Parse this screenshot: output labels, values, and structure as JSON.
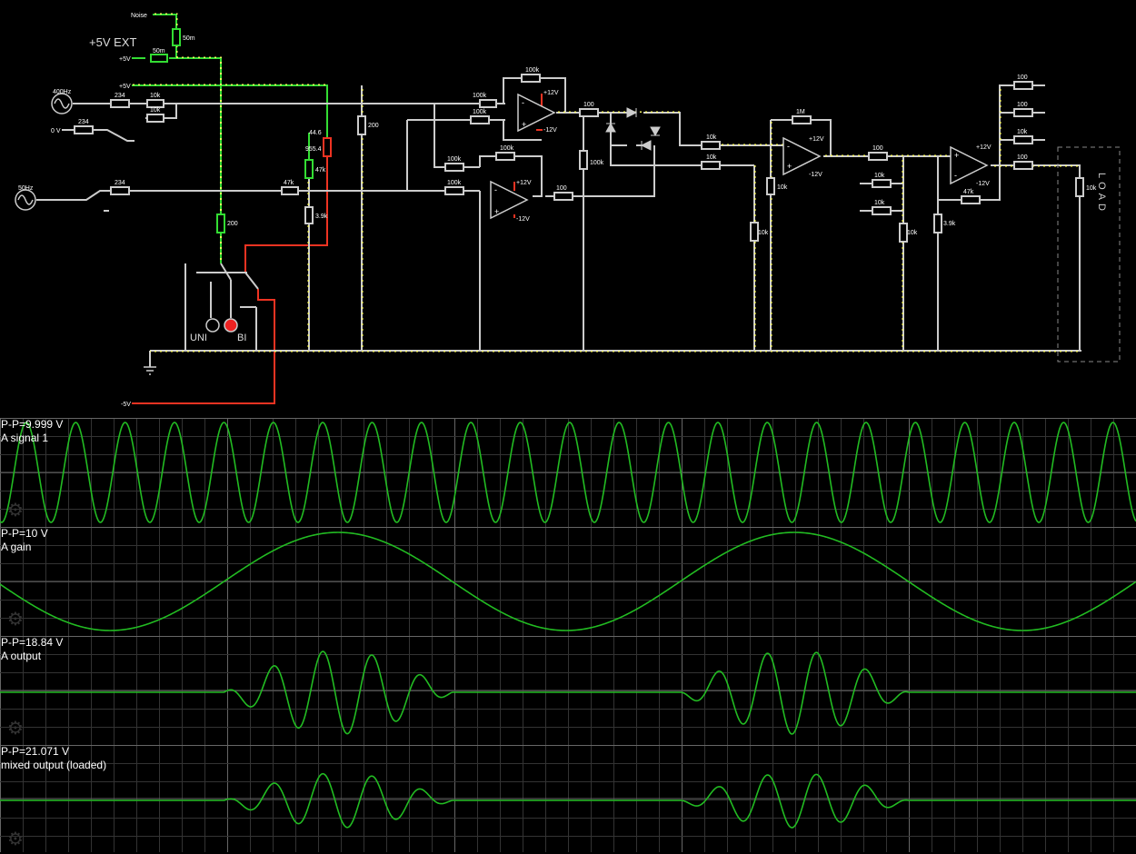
{
  "circuit": {
    "labels": {
      "noise": "Noise",
      "ext": "+5V EXT",
      "plus5a": "+5V",
      "plus5b": "+5V",
      "src400": "400Hz",
      "src50": "50Hz",
      "zerov": "0 V",
      "minus5": "-5V",
      "uni": "UNI",
      "bi": "BI",
      "load": "LOAD",
      "plus12": "+12V",
      "minus12": "-12V"
    },
    "resistors": {
      "r50m_a": "50m",
      "r50m_b": "50m",
      "r234_a": "234",
      "r10k_a": "10k",
      "r10k_b": "10k",
      "r234_b": "234",
      "r234_c": "234",
      "r47k_a": "47k",
      "r200_a": "200",
      "r200_b": "200",
      "pot_val": "44.6",
      "pot_val2": "955.4",
      "r47k_b": "47k",
      "r3_9k_a": "3.9k",
      "r100k_a": "100k",
      "r100k_b": "100k",
      "r100k_c": "100k",
      "r100k_d": "100k",
      "r100k_e": "100k",
      "r100k_f": "100k",
      "r100k_g": "100k",
      "r100_a": "100",
      "r100_b": "100",
      "r10k_c": "10k",
      "r10k_d": "10k",
      "r1m": "1M",
      "r10k_e": "10k",
      "r10k_f": "10k",
      "r100k_h": "10k",
      "r10k_g": "10k",
      "r10k_h": "10k",
      "r10k_i": "10k",
      "r3_9k_b": "3.9k",
      "r47k_c": "47k",
      "r100_c": "100",
      "r100_d": "100",
      "r100_e": "100",
      "r100_f": "100",
      "r10k_load": "10k",
      "r10k_j": "10k"
    },
    "colors": {
      "wire": "#cccccc",
      "current": "#ffff66",
      "pos": "#33dd33",
      "neg": "#ee3322",
      "trace": "#22bb22",
      "grid": "#333333",
      "gridMajor": "#666666"
    }
  },
  "scopes": [
    {
      "pp": "P-P=9.999 V",
      "name": "A signal 1",
      "icon": "gear-icon"
    },
    {
      "pp": "P-P=10 V",
      "name": "A gain",
      "icon": "gear-icon"
    },
    {
      "pp": "P-P=18.84 V",
      "name": "A output",
      "icon": "gear-icon"
    },
    {
      "pp": "P-P=21.071 V",
      "name": "mixed output (loaded)",
      "icon": "gear-icon"
    }
  ]
}
